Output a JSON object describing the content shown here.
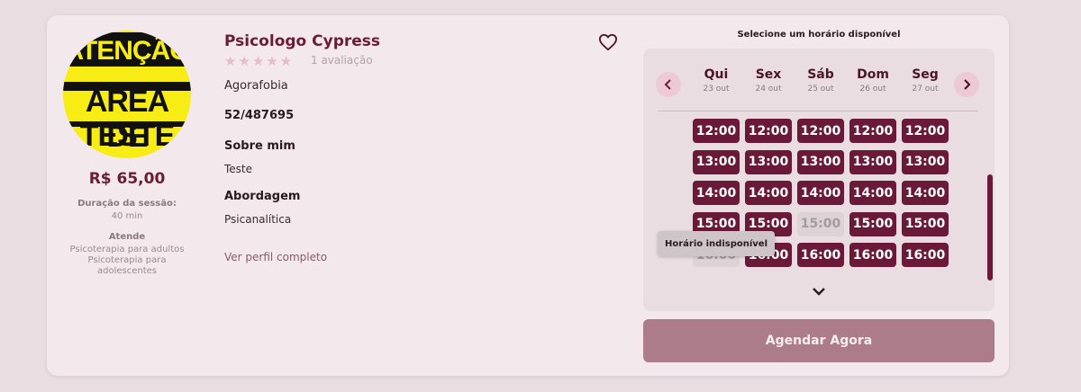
{
  "colors": {
    "background": "#e9dde1",
    "card": "#f3e8ec",
    "brand": "#6a1a38",
    "slot_unavailable": "#ddd3d6",
    "book_button": "#ad7c8a"
  },
  "avatar": {
    "lines": [
      "ATENÇÃO",
      "ÁREA DE",
      "TESTE"
    ]
  },
  "therapist": {
    "name": "Psicologo Cypress",
    "rating_stars": "★★★★★",
    "rating": 0,
    "reviews": "1 avaliação",
    "specialty": "Agorafobia",
    "registration": "52/487695",
    "about_title": "Sobre mim",
    "about_text": "Teste",
    "approach_title": "Abordagem",
    "approach_text": "Psicanalítica",
    "profile_link": "Ver perfil completo",
    "favorite_icon": "heart-icon"
  },
  "session": {
    "price": "R$ 65,00",
    "duration_label": "Duração da sessão:",
    "duration_value": "40 min",
    "serves_label": "Atende",
    "serves_items": [
      "Psicoterapia para adultos",
      "Psicoterapia para",
      "adolescentes"
    ]
  },
  "schedule": {
    "title": "Selecione um horário disponível",
    "prev_icon": "chevron-left-icon",
    "next_icon": "chevron-right-icon",
    "expand_icon": "chevron-down-icon",
    "days": [
      {
        "name": "Qui",
        "date": "23 out"
      },
      {
        "name": "Sex",
        "date": "24 out"
      },
      {
        "name": "Sáb",
        "date": "25 out"
      },
      {
        "name": "Dom",
        "date": "26 out"
      },
      {
        "name": "Seg",
        "date": "27 out"
      }
    ],
    "rows": [
      {
        "time": "12:00",
        "available": [
          true,
          true,
          true,
          true,
          true
        ]
      },
      {
        "time": "13:00",
        "available": [
          true,
          true,
          true,
          true,
          true
        ]
      },
      {
        "time": "14:00",
        "available": [
          true,
          true,
          true,
          true,
          true
        ]
      },
      {
        "time": "15:00",
        "available": [
          true,
          true,
          false,
          true,
          true
        ]
      },
      {
        "time": "16:00",
        "available": [
          false,
          true,
          true,
          true,
          true
        ]
      }
    ],
    "tooltip": "Horário indisponível"
  },
  "book_button": "Agendar Agora"
}
